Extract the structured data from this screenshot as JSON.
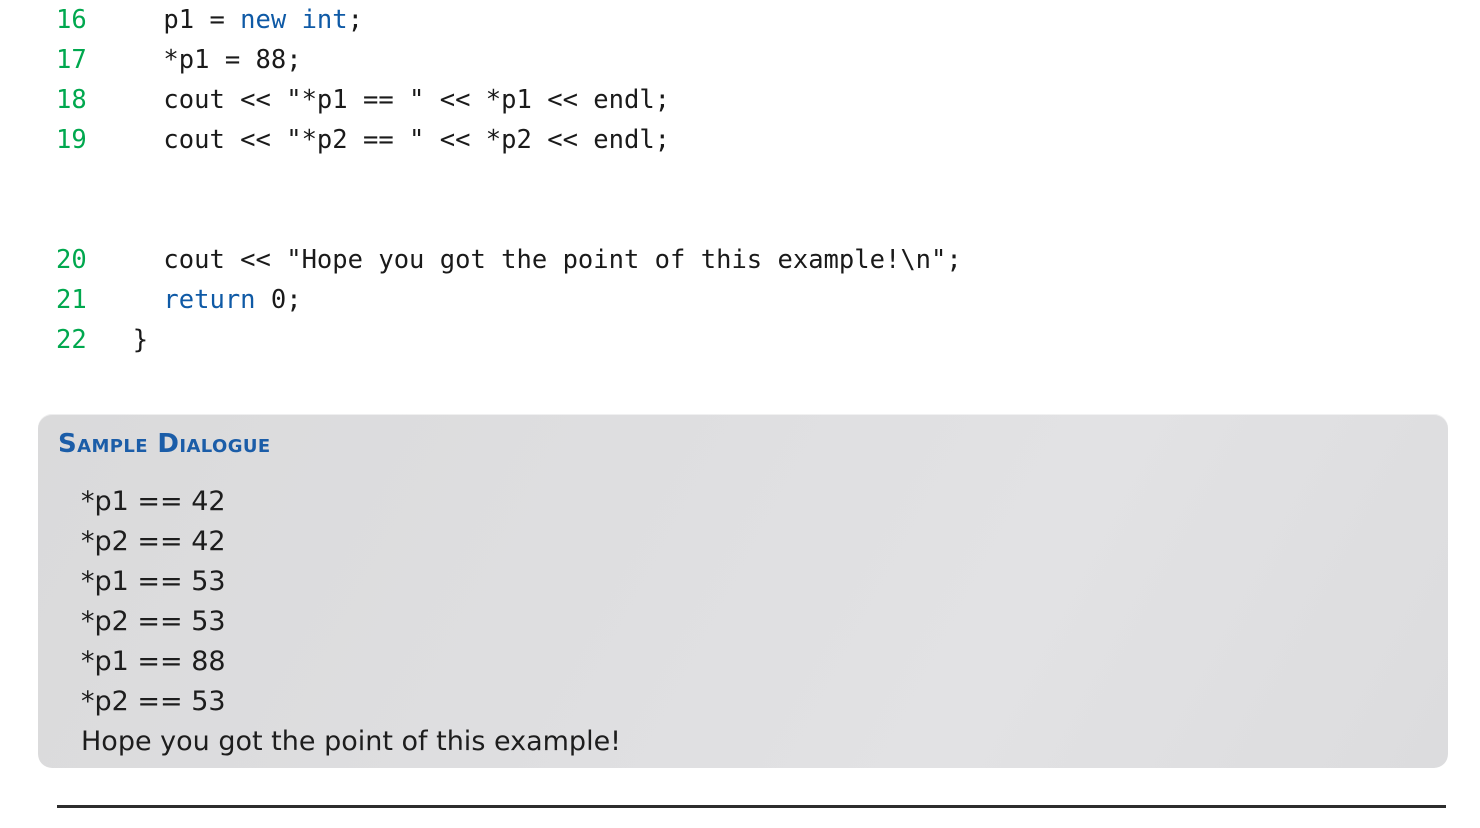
{
  "page": {
    "background_color": "#ffffff"
  },
  "code_listing": {
    "line_number_color": "#00a84e",
    "keyword_color": "#0f5aa6",
    "text_color": "#1a1a1a",
    "lines": [
      {
        "number": "16",
        "segments": [
          {
            "text": "    p1 = ",
            "kind": "plain"
          },
          {
            "text": "new int",
            "kind": "keyword"
          },
          {
            "text": ";",
            "kind": "plain"
          }
        ]
      },
      {
        "number": "17",
        "segments": [
          {
            "text": "    *p1 = 88;",
            "kind": "plain"
          }
        ]
      },
      {
        "number": "18",
        "segments": [
          {
            "text": "    cout << \"*p1 == \" << *p1 << endl;",
            "kind": "plain"
          }
        ]
      },
      {
        "number": "19",
        "segments": [
          {
            "text": "    cout << \"*p2 == \" << *p2 << endl;",
            "kind": "plain"
          }
        ]
      },
      {
        "number": "",
        "segments": [
          {
            "text": "",
            "kind": "plain"
          }
        ]
      },
      {
        "number": "",
        "segments": [
          {
            "text": "",
            "kind": "plain"
          }
        ]
      },
      {
        "number": "20",
        "segments": [
          {
            "text": "    cout << \"Hope you got the point of this example!\\n\";",
            "kind": "plain"
          }
        ]
      },
      {
        "number": "21",
        "segments": [
          {
            "text": "    ",
            "kind": "plain"
          },
          {
            "text": "return",
            "kind": "keyword"
          },
          {
            "text": " 0;",
            "kind": "plain"
          }
        ]
      },
      {
        "number": "22",
        "segments": [
          {
            "text": "  }",
            "kind": "plain"
          }
        ]
      }
    ]
  },
  "sample_dialogue": {
    "heading": "Sample Dialogue",
    "heading_color": "#1b5da8",
    "panel_color": "#dcdcde",
    "output_lines": [
      "*p1 == 42",
      "*p2 == 42",
      "*p1 == 53",
      "*p2 == 53",
      "*p1 == 88",
      "*p2 == 53",
      "Hope you got the point of this example!"
    ]
  },
  "bottom_rule": {
    "color": "#2d2d2d"
  }
}
